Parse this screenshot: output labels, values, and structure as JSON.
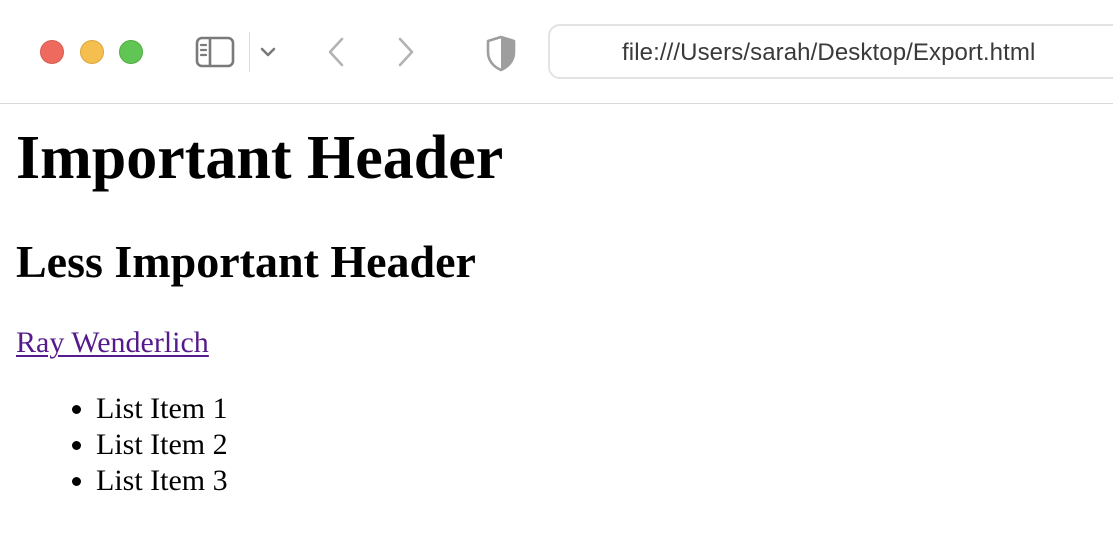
{
  "browser": {
    "window_controls": [
      "close",
      "minimize",
      "maximize"
    ],
    "icons": {
      "sidebar": "sidebar-icon",
      "tab_overview": "chevron-down-icon",
      "back": "chevron-left-icon",
      "forward": "chevron-right-icon",
      "privacy": "shield-icon"
    },
    "address": "file:///Users/sarah/Desktop/Export.html"
  },
  "colors": {
    "close": "#ee6a5f",
    "minimize": "#f5bf4f",
    "maximize": "#61c554",
    "link_visited": "#551a8b",
    "text": "#000000"
  },
  "page": {
    "heading1": "Important Header",
    "heading2": "Less Important Header",
    "link_text": "Ray Wenderlich",
    "list_items": [
      "List Item 1",
      "List Item 2",
      "List Item 3"
    ]
  }
}
